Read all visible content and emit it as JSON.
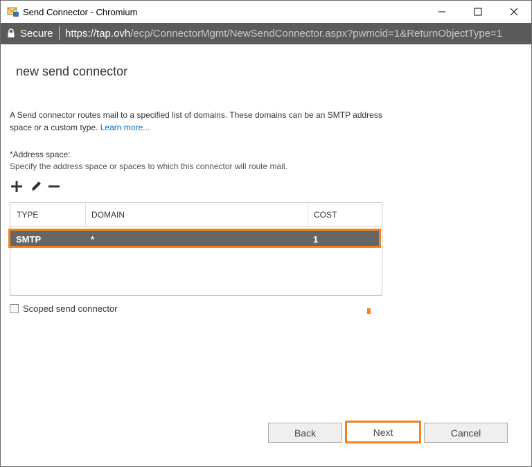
{
  "window": {
    "title": "Send Connector - Chromium",
    "app_icon": "mail-connector-icon",
    "controls": {
      "minimize": "minimize-icon",
      "maximize": "maximize-icon",
      "close": "close-icon"
    }
  },
  "address_bar": {
    "secure_label": "Secure",
    "url_host": "https://tap.ovh",
    "url_path": "/ecp/ConnectorMgmt/NewSendConnector.aspx?pwmcid=1&ReturnObjectType=1"
  },
  "page": {
    "heading": "new send connector",
    "description": "A Send connector routes mail to a specified list of domains. These domains can be an SMTP address space or a custom type.",
    "learn_more": "Learn more...",
    "address_space_label": "*Address space:",
    "address_space_help": "Specify the address space or spaces to which this connector will route mail."
  },
  "toolbar": {
    "add": "plus-icon",
    "edit": "pencil-icon",
    "remove": "minus-icon"
  },
  "grid": {
    "columns": [
      "TYPE",
      "DOMAIN",
      "COST"
    ],
    "rows": [
      {
        "type": "SMTP",
        "domain": "*",
        "cost": "1"
      }
    ]
  },
  "scoped": {
    "label": "Scoped send connector",
    "checked": false
  },
  "buttons": {
    "back": "Back",
    "next": "Next",
    "cancel": "Cancel"
  },
  "colors": {
    "accent": "#f5821f",
    "address_bar": "#5b5b5b",
    "selected_row": "#666666",
    "link": "#0072c6"
  }
}
